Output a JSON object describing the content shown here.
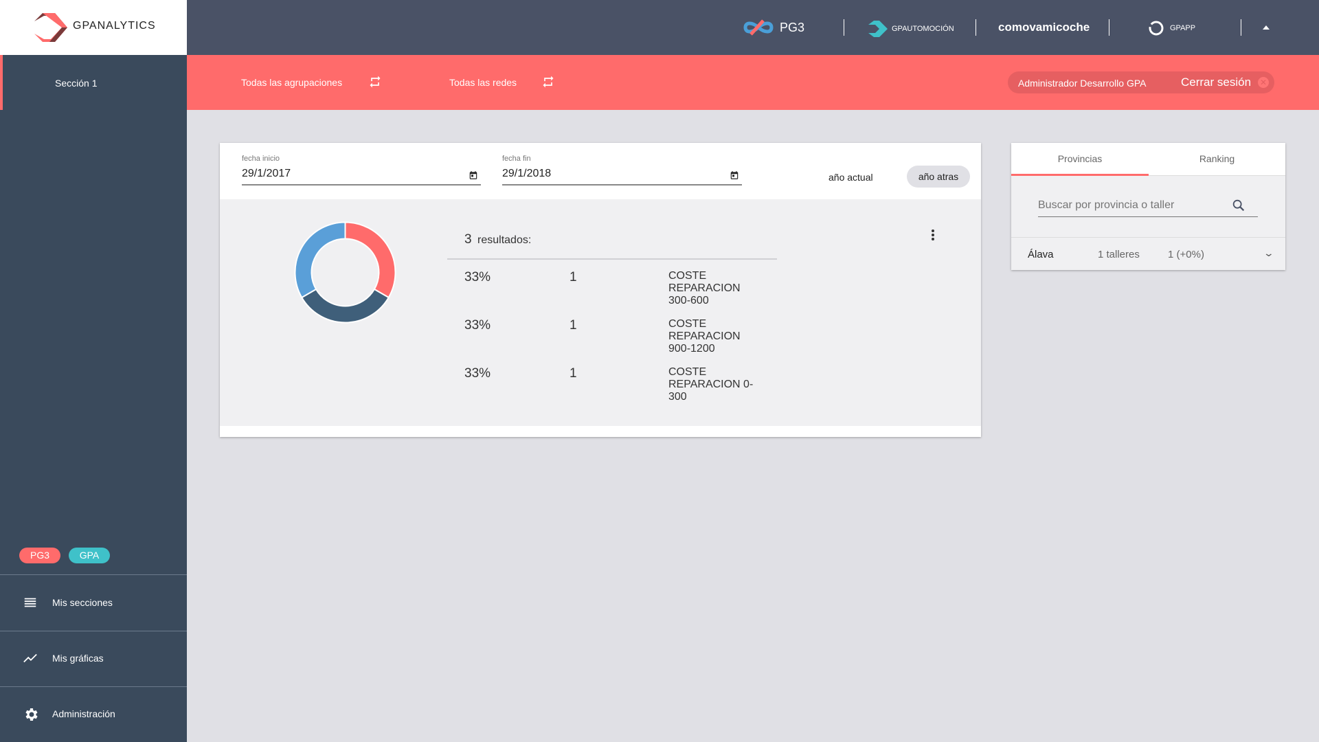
{
  "brand": {
    "name": "GPANALYTICS"
  },
  "topbar": {
    "logos": [
      {
        "name": "PG3"
      },
      {
        "name": "GPAUTOMOCIÓN"
      },
      {
        "name": "comovamicoche"
      },
      {
        "name": "GPAPP"
      }
    ]
  },
  "sidebar": {
    "section": "Sección 1",
    "badges": [
      {
        "label": "PG3",
        "color": "#ff6b6b"
      },
      {
        "label": "GPA",
        "color": "#3fc1c9"
      }
    ],
    "menu": [
      {
        "label": "Mis secciones",
        "icon": "list-icon"
      },
      {
        "label": "Mis gráficas",
        "icon": "trend-icon"
      },
      {
        "label": "Administración",
        "icon": "gear-icon"
      }
    ]
  },
  "filters": {
    "groups": "Todas las agrupaciones",
    "networks": "Todas las redes",
    "user": "Administrador Desarrollo GPA",
    "logout": "Cerrar sesión"
  },
  "dates": {
    "start_label": "fecha inicio",
    "start_value": "29/1/2017",
    "end_label": "fecha fin",
    "end_value": "29/1/2018",
    "current_year": "año actual",
    "year_back": "año atras"
  },
  "results": {
    "count": "3",
    "label": "resultados:",
    "rows": [
      {
        "pct": "33%",
        "count": "1",
        "category": "COSTE REPARACION 300-600"
      },
      {
        "pct": "33%",
        "count": "1",
        "category": "COSTE REPARACION 900-1200"
      },
      {
        "pct": "33%",
        "count": "1",
        "category": "COSTE REPARACION 0-300"
      }
    ]
  },
  "chart_data": {
    "type": "pie",
    "donut": true,
    "categories": [
      "COSTE REPARACION 300-600",
      "COSTE REPARACION 900-1200",
      "COSTE REPARACION 0-300"
    ],
    "values": [
      1,
      1,
      1
    ],
    "colors": [
      "#ff6b6b",
      "#3f5f7a",
      "#5a9fd8"
    ]
  },
  "panel": {
    "tabs": [
      "Provincias",
      "Ranking"
    ],
    "active_tab": 0,
    "search_placeholder": "Buscar por provincia o taller",
    "rows": [
      {
        "province": "Álava",
        "workshops": "1 talleres",
        "value": "1 (+0%)"
      }
    ]
  },
  "colors": {
    "accent": "#ff6b6b",
    "sidebar": "#3a4a5c",
    "header": "#4a5266"
  }
}
